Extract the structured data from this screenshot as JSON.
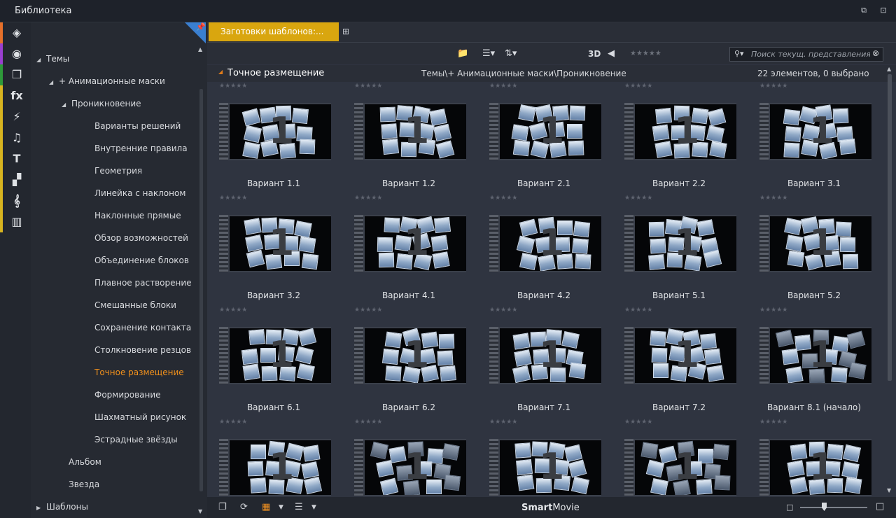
{
  "window": {
    "title": "Библиотека",
    "restore_icon": "restore-icon",
    "undock_icon": "undock-icon"
  },
  "rail": {
    "items": [
      {
        "name": "project-bin-icon",
        "glyph": "◈",
        "stripe": "#e6702a"
      },
      {
        "name": "film-reel-icon",
        "glyph": "◉",
        "stripe": "#9a3fd0"
      },
      {
        "name": "photo-stack-icon",
        "glyph": "❐",
        "stripe": "#2e9a3a"
      },
      {
        "name": "effects-icon",
        "glyph": "fx",
        "stripe": "#d8b420"
      },
      {
        "name": "transitions-icon",
        "glyph": "⚡",
        "stripe": "#d8b420"
      },
      {
        "name": "music-icon",
        "glyph": "♫",
        "stripe": "#d8b420"
      },
      {
        "name": "title-icon",
        "glyph": "T",
        "stripe": "#d8b420"
      },
      {
        "name": "montage-icon",
        "glyph": "▞",
        "stripe": "#d8b420"
      },
      {
        "name": "score-icon",
        "glyph": "𝄞",
        "stripe": "#d8b420"
      },
      {
        "name": "piano-icon",
        "glyph": "▥",
        "stripe": "#d8b420"
      }
    ]
  },
  "tree": {
    "items": [
      {
        "label": "Темы",
        "expand": "◢",
        "selected": false
      },
      {
        "label": "+ Анимационные маски",
        "expand": "◢",
        "selected": false
      },
      {
        "label": "Проникновение",
        "expand": "◢",
        "selected": false
      },
      {
        "label": "Варианты решений",
        "expand": "",
        "selected": false
      },
      {
        "label": "Внутренние правила",
        "expand": "",
        "selected": false
      },
      {
        "label": "Геометрия",
        "expand": "",
        "selected": false
      },
      {
        "label": "Линейка с наклоном",
        "expand": "",
        "selected": false
      },
      {
        "label": "Наклонные прямые",
        "expand": "",
        "selected": false
      },
      {
        "label": "Обзор возможностей",
        "expand": "",
        "selected": false
      },
      {
        "label": "Объединение блоков",
        "expand": "",
        "selected": false
      },
      {
        "label": "Плавное растворение",
        "expand": "",
        "selected": false
      },
      {
        "label": "Смешанные блоки",
        "expand": "",
        "selected": false
      },
      {
        "label": "Сохранение контакта",
        "expand": "",
        "selected": false
      },
      {
        "label": "Столкновение резцов",
        "expand": "",
        "selected": false
      },
      {
        "label": "Точное размещение",
        "expand": "",
        "selected": true
      },
      {
        "label": "Формирование",
        "expand": "",
        "selected": false
      },
      {
        "label": "Шахматный рисунок",
        "expand": "",
        "selected": false
      },
      {
        "label": "Эстрадные звёзды",
        "expand": "",
        "selected": false
      },
      {
        "label": "Альбом",
        "expand": "",
        "selected": false
      },
      {
        "label": "Звезда",
        "expand": "",
        "selected": false
      },
      {
        "label": "Шаблоны",
        "expand": "▶",
        "selected": false
      }
    ],
    "selected_color": "#f0901c"
  },
  "tabs": {
    "active_label": "Заготовки шаблонов:...",
    "active_color": "#d9a60f"
  },
  "toolbar": {
    "view_3d": "3D",
    "stars": "★★★★★"
  },
  "search": {
    "placeholder": "Поиск текущ. представления",
    "value": ""
  },
  "path": {
    "title": "Точное размещение",
    "breadcrumb": "Темы\\+ Анимационные маски\\Проникновение",
    "count": "22 элементов, 0 выбрано"
  },
  "grid": {
    "stars": "★★★★★",
    "items": [
      {
        "name": "Вариант 1.1",
        "tiles": "normal"
      },
      {
        "name": "Вариант 1.2",
        "tiles": "normal"
      },
      {
        "name": "Вариант 2.1",
        "tiles": "normal"
      },
      {
        "name": "Вариант 2.2",
        "tiles": "normal"
      },
      {
        "name": "Вариант 3.1",
        "tiles": "normal"
      },
      {
        "name": "Вариант 3.2",
        "tiles": "normal"
      },
      {
        "name": "Вариант 4.1",
        "tiles": "normal"
      },
      {
        "name": "Вариант 4.2",
        "tiles": "normal"
      },
      {
        "name": "Вариант 5.1",
        "tiles": "normal"
      },
      {
        "name": "Вариант 5.2",
        "tiles": "normal"
      },
      {
        "name": "Вариант 6.1",
        "tiles": "normal"
      },
      {
        "name": "Вариант 6.2",
        "tiles": "normal"
      },
      {
        "name": "Вариант 7.1",
        "tiles": "normal"
      },
      {
        "name": "Вариант 7.2",
        "tiles": "normal"
      },
      {
        "name": "Вариант 8.1 (начало)",
        "tiles": "dark"
      },
      {
        "name": "",
        "tiles": "normal"
      },
      {
        "name": "",
        "tiles": "dark"
      },
      {
        "name": "",
        "tiles": "normal"
      },
      {
        "name": "",
        "tiles": "dark"
      },
      {
        "name": "",
        "tiles": "normal"
      }
    ]
  },
  "bottombar": {
    "brand_bold": "Smart",
    "brand_rest": "Movie"
  }
}
